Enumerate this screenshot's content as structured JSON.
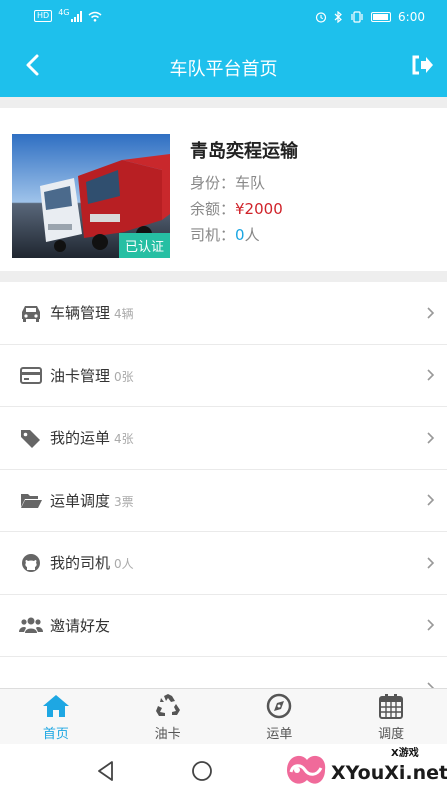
{
  "status_bar": {
    "hd": "HD",
    "network": "4G",
    "time": "6:00"
  },
  "nav": {
    "title": "车队平台首页"
  },
  "profile": {
    "badge": "已认证",
    "name": "青岛奕程运输",
    "identity_label": "身份：",
    "identity_value": "车队",
    "balance_label": "余额：",
    "balance_value": "¥2000",
    "drivers_label": "司机：",
    "drivers_count": "0",
    "drivers_unit": "人"
  },
  "menu": [
    {
      "label": "车辆管理",
      "count": "4辆",
      "icon": "car-icon"
    },
    {
      "label": "油卡管理",
      "count": "0张",
      "icon": "card-icon"
    },
    {
      "label": "我的运单",
      "count": "4张",
      "icon": "tags-icon"
    },
    {
      "label": "运单调度",
      "count": "3票",
      "icon": "folder-open-icon"
    },
    {
      "label": "我的司机",
      "count": "0人",
      "icon": "github-icon"
    },
    {
      "label": "邀请好友",
      "count": "",
      "icon": "users-icon"
    },
    {
      "label": "",
      "count": "",
      "icon": "partial-row"
    }
  ],
  "tabbar": [
    {
      "label": "首页",
      "icon": "home-icon",
      "active": true
    },
    {
      "label": "油卡",
      "icon": "recycle-icon",
      "active": false
    },
    {
      "label": "运单",
      "icon": "compass-icon",
      "active": false
    },
    {
      "label": "调度",
      "icon": "calendar-icon",
      "active": false
    }
  ],
  "watermark": {
    "brand": "XYouXi.net",
    "tag": "X游戏"
  },
  "colors": {
    "primary": "#1ec0ec",
    "accent_red": "#d0232a",
    "accent_blue": "#1ba6e2",
    "badge_green": "#26bfa3"
  }
}
